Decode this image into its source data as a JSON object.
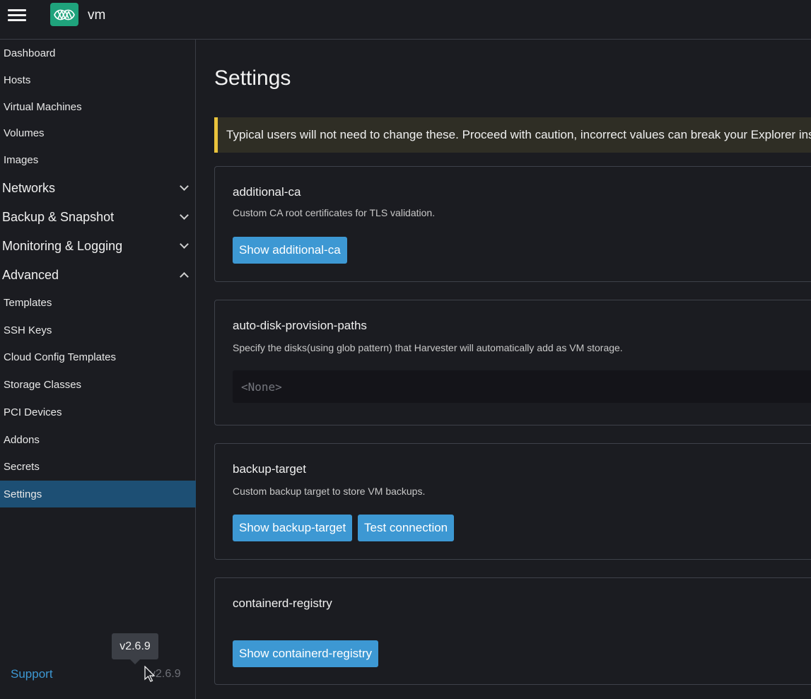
{
  "header": {
    "cluster_name": "vm"
  },
  "sidebar": {
    "items": [
      {
        "label": "Dashboard"
      },
      {
        "label": "Hosts"
      },
      {
        "label": "Virtual Machines"
      },
      {
        "label": "Volumes"
      },
      {
        "label": "Images"
      },
      {
        "label": "Networks",
        "expanded": false
      },
      {
        "label": "Backup & Snapshot",
        "expanded": false
      },
      {
        "label": "Monitoring & Logging",
        "expanded": false
      },
      {
        "label": "Advanced",
        "expanded": true
      },
      {
        "label": "Templates"
      },
      {
        "label": "SSH Keys"
      },
      {
        "label": "Cloud Config Templates"
      },
      {
        "label": "Storage Classes"
      },
      {
        "label": "PCI Devices"
      },
      {
        "label": "Addons"
      },
      {
        "label": "Secrets"
      },
      {
        "label": "Settings",
        "active": true
      }
    ],
    "support_label": "Support",
    "version": "v2.6.9",
    "tooltip": "v2.6.9"
  },
  "main": {
    "title": "Settings",
    "banner": "Typical users will not need to change these. Proceed with caution, incorrect values can break your Explorer ins",
    "settings": [
      {
        "name": "additional-ca",
        "description": "Custom CA root certificates for TLS validation.",
        "buttons": [
          "Show additional-ca"
        ]
      },
      {
        "name": "auto-disk-provision-paths",
        "description": "Specify the disks(using glob pattern) that Harvester will automatically add as VM storage.",
        "value": "<None>"
      },
      {
        "name": "backup-target",
        "description": "Custom backup target to store VM backups.",
        "buttons": [
          "Show backup-target",
          "Test connection"
        ]
      },
      {
        "name": "containerd-registry",
        "description": "",
        "buttons": [
          "Show containerd-registry"
        ]
      }
    ]
  },
  "colors": {
    "accent": "#3d98d3",
    "active_nav": "#1d4f74",
    "warning": "#e9c33c",
    "logo": "#1fa37c"
  }
}
